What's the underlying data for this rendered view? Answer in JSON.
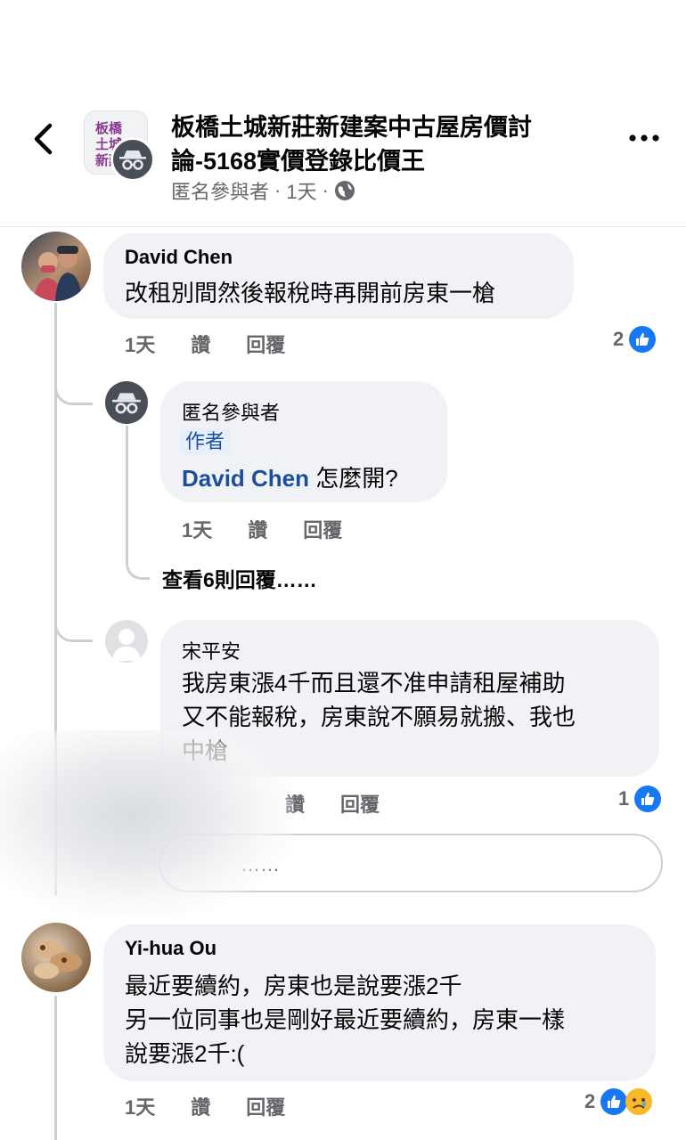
{
  "header": {
    "group_title": "板橋土城新莊新建案中古屋房價討論-5168實價登錄比價王",
    "group_logo_text": "板橋土城新莊",
    "poster": "匿名參與者",
    "time": "1天",
    "dot": "·",
    "privacy_icon": "globe-icon",
    "back_icon": "chevron-left-icon",
    "more_icon": "more-icon"
  },
  "comments": [
    {
      "author": "David Chen",
      "text": "改租別間然後報稅時再開前房東一槍",
      "time": "1天",
      "like_label": "讚",
      "reply_label": "回覆",
      "reaction_count": "2",
      "replies": [
        {
          "author": "匿名參與者",
          "badge": "作者",
          "mention": "David Chen",
          "text": "怎麼開?",
          "time": "1天",
          "like_label": "讚",
          "reply_label": "回覆"
        }
      ],
      "view_more_replies": "查看6則回覆……"
    },
    {
      "author": "宋平安",
      "text_lines": [
        "我房東漲4千而且還不准申請租屋補助",
        "又不能報稅，房東說不願易就搬、我也",
        "中槍"
      ],
      "like_label": "讚",
      "reply_label": "回覆",
      "reaction_count": "1",
      "reply_placeholder": "……"
    },
    {
      "author": "Yi-hua Ou",
      "text_lines": [
        "最近要續約，房東也是說要漲2千",
        "另一位同事也是剛好最近要續約，房東一樣",
        "說要漲2千:("
      ],
      "time": "1天",
      "like_label": "讚",
      "reply_label": "回覆",
      "reaction_count": "2"
    }
  ],
  "colors": {
    "bubble": "#f0f2f5",
    "meta_text": "#65676b",
    "like_blue": "#1877f2",
    "mention_blue": "#1b4f9c",
    "thread_line": "#ccd0d5"
  }
}
